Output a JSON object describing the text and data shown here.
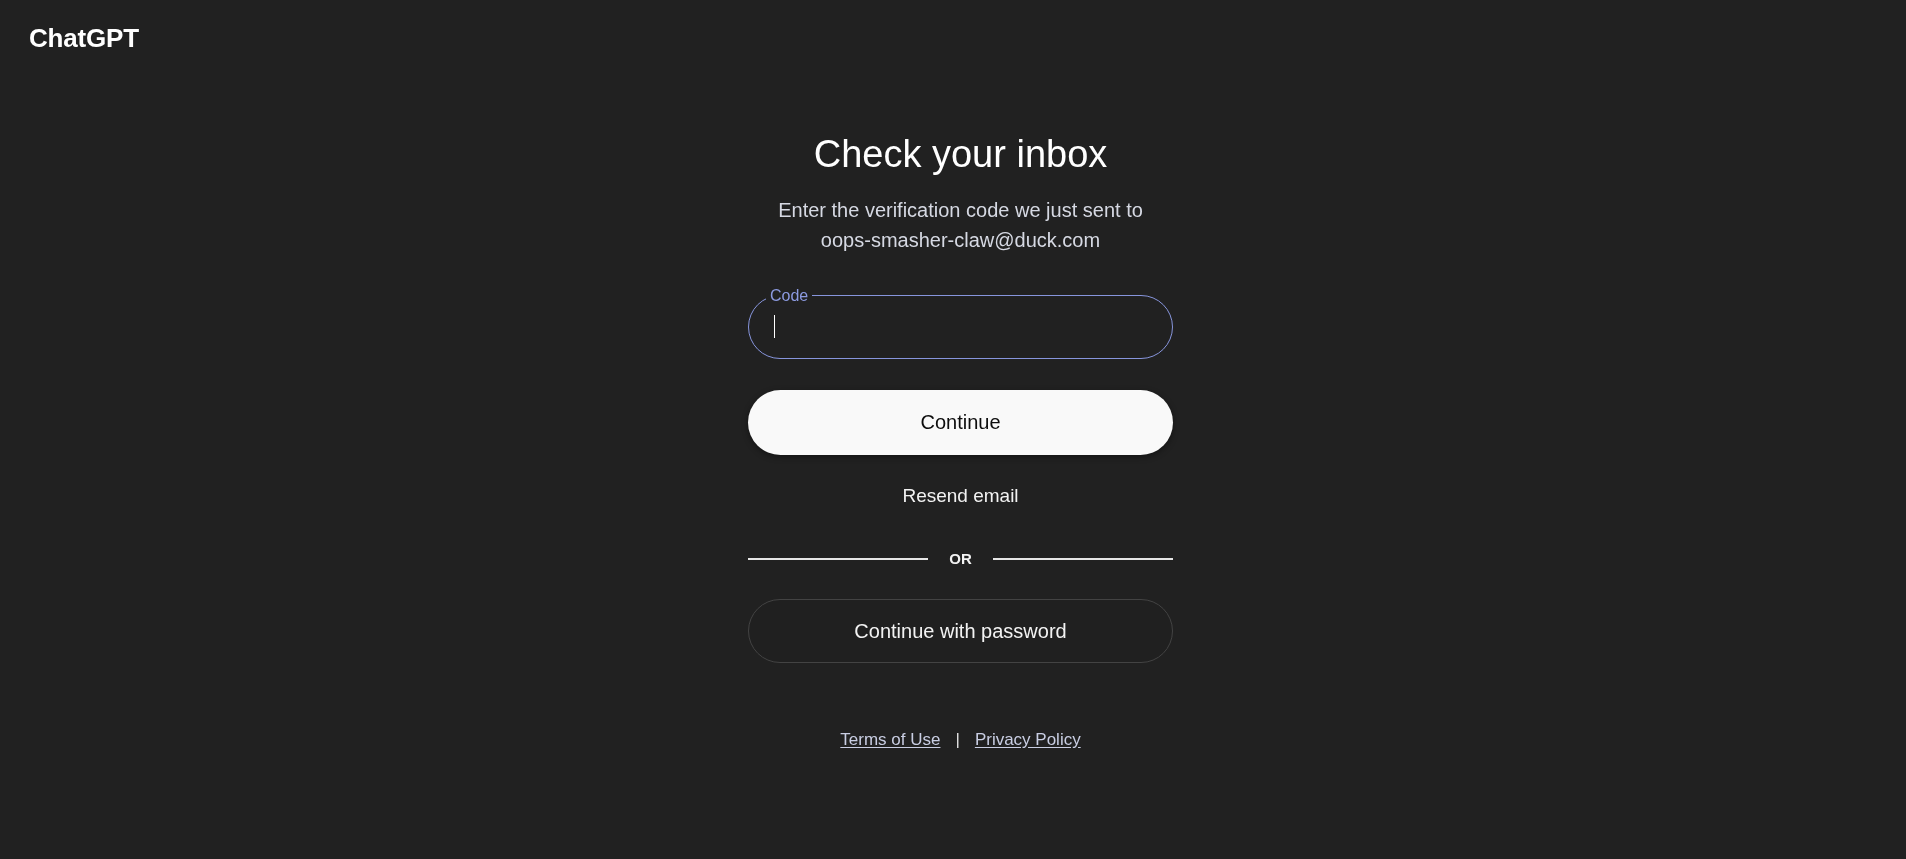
{
  "header": {
    "logo": "ChatGPT"
  },
  "form": {
    "title": "Check your inbox",
    "instructions": "Enter the verification code we just sent to oops-smasher-claw@duck.com",
    "code_field": {
      "label": "Code",
      "focused": true
    },
    "actions": [
      {
        "label": "Continue",
        "kind": "primary"
      },
      {
        "label": "Resend email",
        "kind": "text"
      }
    ],
    "divider": "OR",
    "alternatives": [
      {
        "label": "Continue with password",
        "kind": "outline"
      }
    ]
  },
  "footer": {
    "links": [
      "Terms of Use",
      "Privacy Policy"
    ],
    "separator": "|"
  }
}
